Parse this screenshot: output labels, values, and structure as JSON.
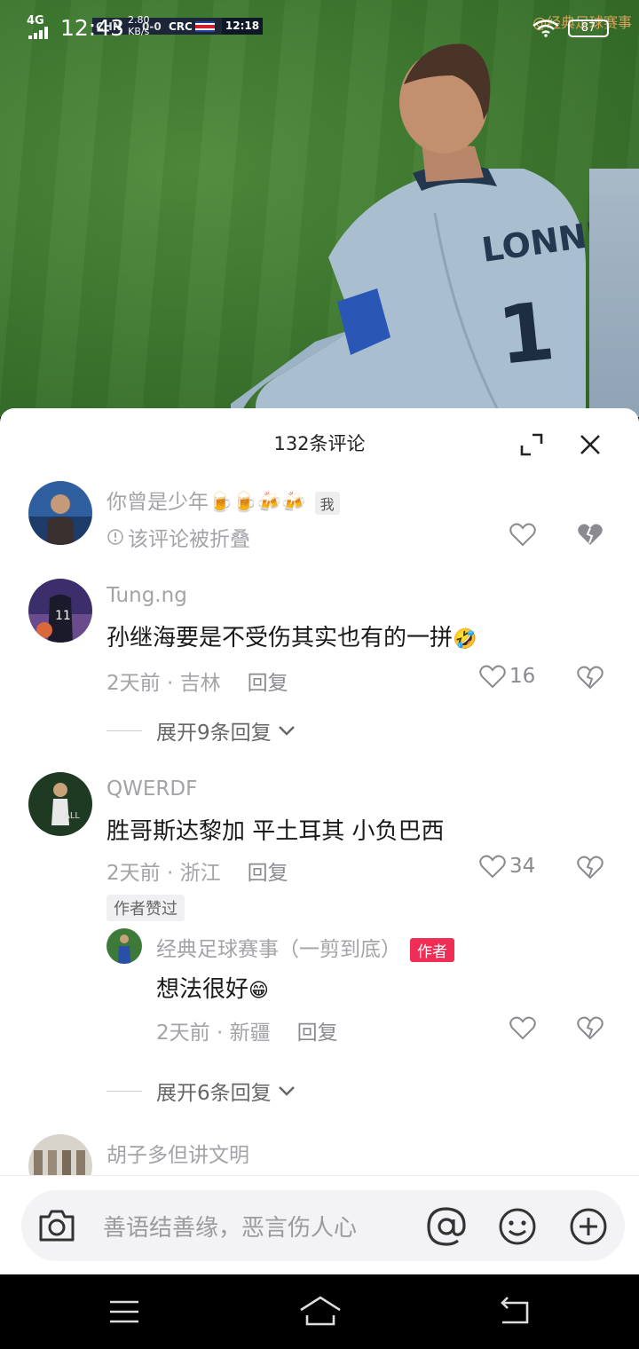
{
  "status_bar": {
    "network": "4G",
    "time": "12:43",
    "net_speed": "2.80",
    "net_speed_unit": "KB/s",
    "battery": "87"
  },
  "video_overlay": {
    "team_home": "CHN",
    "score": "0-0",
    "team_away": "CRC",
    "match_time": "12:18",
    "watermark": "@经典足球赛事",
    "jersey_name": "LONNIS",
    "jersey_number": "1"
  },
  "sheet": {
    "title": "132条评论"
  },
  "comments": [
    {
      "username": "你曾是少年",
      "emojis": "🍺🍺🍻🍻",
      "tag": "我",
      "folded_text": "该评论被折叠"
    },
    {
      "username": "Tung.ng",
      "text": "孙继海要是不受伤其实也有的一拼",
      "emoji": "🤣",
      "time": "2天前",
      "location": "吉林",
      "reply_label": "回复",
      "likes": "16",
      "expand_label": "展开9条回复"
    },
    {
      "username": "QWERDF",
      "text": "胜哥斯达黎加 平土耳其 小负巴西",
      "time": "2天前",
      "location": "浙江",
      "reply_label": "回复",
      "likes": "34",
      "liked_badge": "作者赞过",
      "reply": {
        "username": "经典足球赛事（一剪到底）",
        "tag": "作者",
        "text": "想法很好",
        "emoji": "😁",
        "time": "2天前",
        "location": "新疆",
        "reply_label": "回复"
      },
      "expand_label": "展开6条回复"
    },
    {
      "username": "胡子多但讲文明"
    }
  ],
  "input": {
    "placeholder": "善语结善缘，恶言伤人心"
  },
  "colors": {
    "author_tag": "#f02e55",
    "muted_text": "#a3a3a8"
  }
}
